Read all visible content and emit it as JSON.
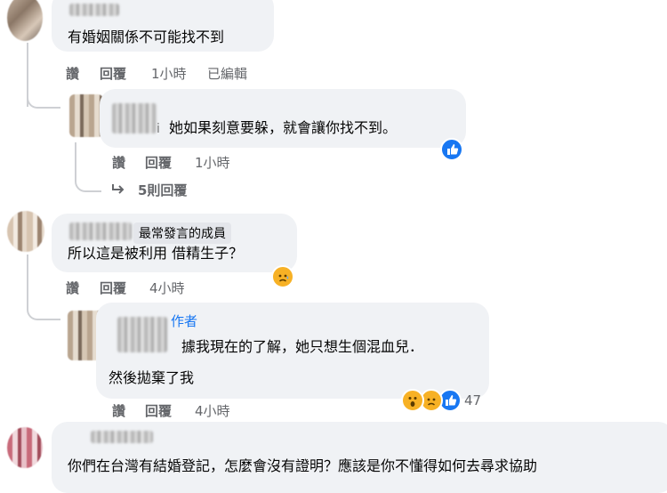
{
  "comments": [
    {
      "text": "有婚姻關係不可能找不到",
      "actions": {
        "like": "讚",
        "reply": "回覆",
        "time": "1小時",
        "edited": "已編輯"
      },
      "replies": [
        {
          "text": "她如果刻意要躲，就會讓你找不到。",
          "name_tail": "i",
          "actions": {
            "like": "讚",
            "reply": "回覆",
            "time": "1小時"
          },
          "reactions": [
            "like-icon"
          ]
        }
      ],
      "more_replies": "5則回覆"
    },
    {
      "badge": "最常發言的成員",
      "text": "所以這是被利用 借精生子？",
      "actions": {
        "like": "讚",
        "reply": "回覆",
        "time": "4小時"
      },
      "reactions": [
        "sad-icon"
      ],
      "replies": [
        {
          "author_badge": "作者",
          "text_line1": "據我現在的了解，她只想生個混血兒．",
          "text_line2": "然後拋棄了我",
          "actions": {
            "like": "讚",
            "reply": "回覆",
            "time": "4小時"
          },
          "reactions": [
            "wow-icon",
            "sad-icon",
            "like-icon"
          ],
          "reaction_count": "47"
        }
      ]
    },
    {
      "text": "你們在台灣有結婚登記，怎麼會沒有證明？應該是你不懂得如何去尋求協助"
    }
  ],
  "colors": {
    "bubble": "#f0f2f5",
    "meta_text": "#65676b",
    "author_badge": "#1877f2",
    "like_reaction": "#1877f2",
    "emoji_reaction": "#f7b125"
  }
}
